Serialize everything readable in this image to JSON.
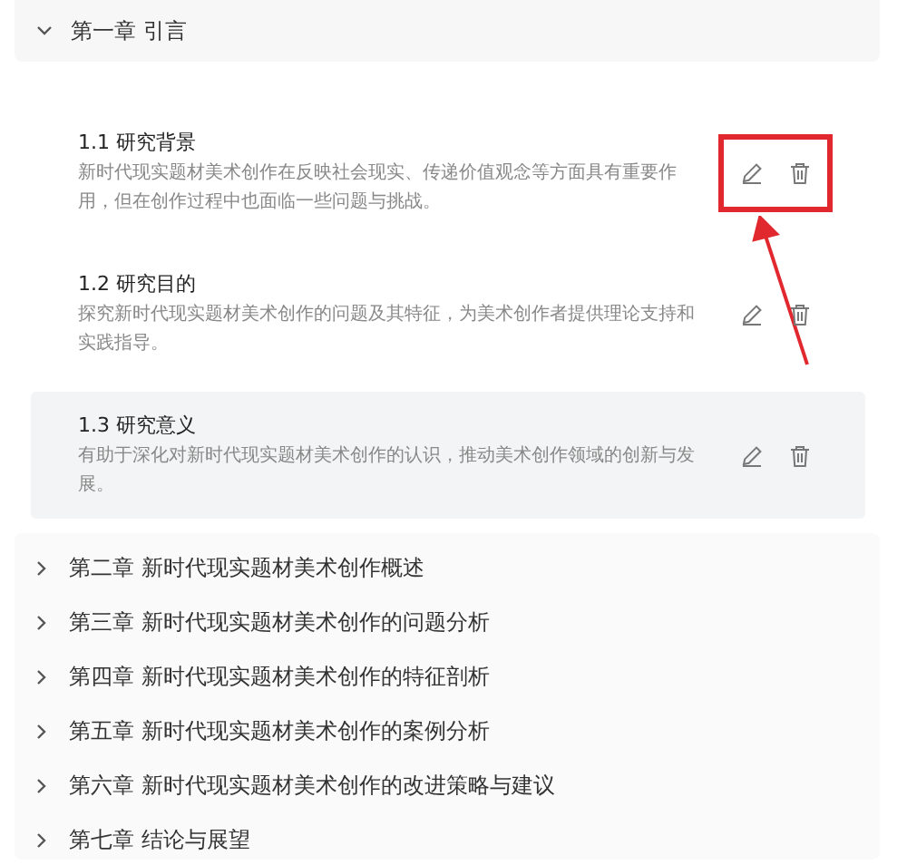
{
  "chapters": [
    {
      "title": "第一章 引言",
      "expanded": true,
      "sections": [
        {
          "title": "1.1 研究背景",
          "description": "新时代现实题材美术创作在反映社会现实、传递价值观念等方面具有重要作用，但在创作过程中也面临一些问题与挑战。",
          "hovered": false,
          "annotated": true
        },
        {
          "title": "1.2 研究目的",
          "description": "探究新时代现实题材美术创作的问题及其特征，为美术创作者提供理论支持和实践指导。",
          "hovered": false,
          "annotated": false
        },
        {
          "title": "1.3 研究意义",
          "description": "有助于深化对新时代现实题材美术创作的认识，推动美术创作领域的创新与发展。",
          "hovered": true,
          "annotated": false
        }
      ]
    },
    {
      "title": "第二章 新时代现实题材美术创作概述",
      "expanded": false
    },
    {
      "title": "第三章 新时代现实题材美术创作的问题分析",
      "expanded": false
    },
    {
      "title": "第四章 新时代现实题材美术创作的特征剖析",
      "expanded": false
    },
    {
      "title": "第五章 新时代现实题材美术创作的案例分析",
      "expanded": false
    },
    {
      "title": "第六章 新时代现实题材美术创作的改进策略与建议",
      "expanded": false
    },
    {
      "title": "第七章 结论与展望",
      "expanded": false
    }
  ]
}
